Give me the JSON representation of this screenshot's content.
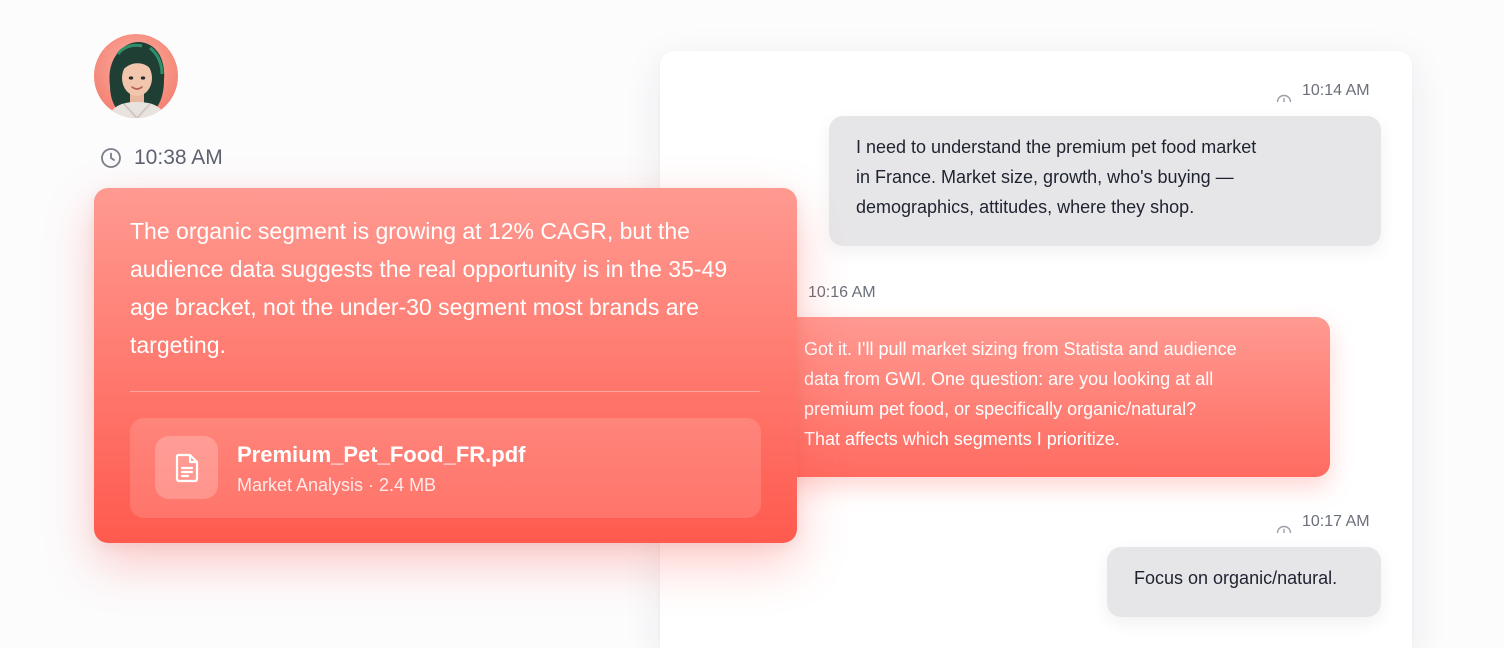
{
  "left_card": {
    "time": "10:38 AM",
    "message": "The organic segment is growing at 12% CAGR, but the audience data suggests the real opportunity is in the 35-49 age bracket, not the under-30 segment most brands are targeting.",
    "attachment": {
      "name": "Premium_Pet_Food_FR.pdf",
      "meta": "Market Analysis · 2.4 MB",
      "icon": "document-icon"
    }
  },
  "chat": {
    "messages": [
      {
        "sender": "user",
        "time": "10:14 AM",
        "lines": [
          "I need to understand the premium pet food market",
          "in France. Market size, growth, who's buying —",
          "demographics, attitudes, where they shop."
        ]
      },
      {
        "sender": "assistant",
        "time": "10:16 AM",
        "lines": [
          "Got it. I'll pull market sizing from Statista and audience",
          "data from GWI. One question: are you looking at all",
          "premium pet food, or specifically organic/natural?",
          "That affects which segments I prioritize."
        ]
      },
      {
        "sender": "user",
        "time": "10:17 AM",
        "lines": [
          "Focus on organic/natural."
        ]
      }
    ]
  },
  "colors": {
    "accent_top": "#ff9a92",
    "accent_bottom": "#ff5a4e",
    "user_bubble": "#e6e6e9"
  }
}
